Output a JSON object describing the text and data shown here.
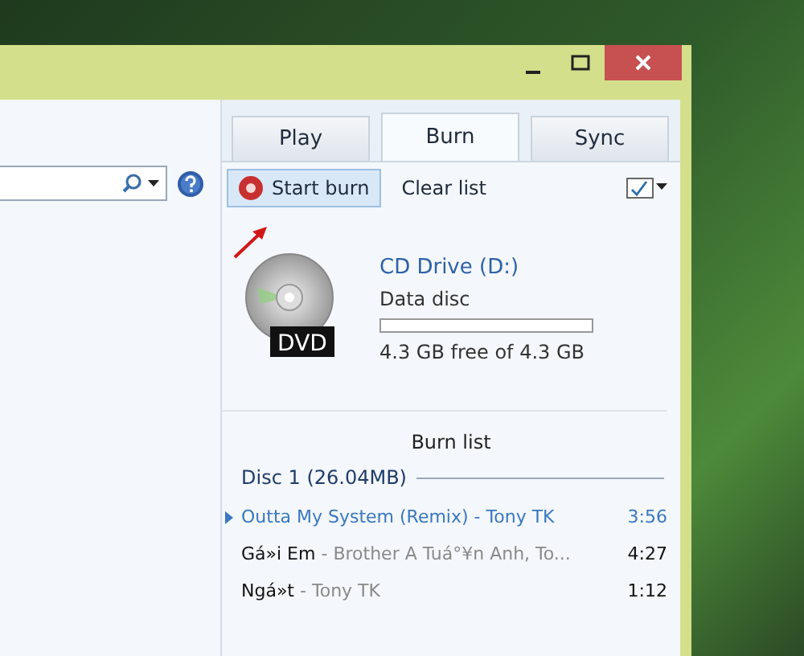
{
  "tabs": [
    {
      "label": "Play",
      "selected": false
    },
    {
      "label": "Burn",
      "selected": true
    },
    {
      "label": "Sync",
      "selected": false
    }
  ],
  "toolbar": {
    "buttons": [
      "Start burn",
      "Clear list"
    ]
  },
  "drive": {
    "name": "CD Drive (D:)",
    "disc_type": "Data disc",
    "level": 0,
    "free": "4.3 GB free of 4.3 GB",
    "disc_label": "DVD"
  },
  "burn_list": {
    "title": "Burn list",
    "disc": "Disc 1 (26.04MB)",
    "tracks": [
      {
        "title": "Outta My System (Remix)",
        "separator": "-",
        "artist": "Tony TK",
        "duration": "3:56",
        "playing": true
      },
      {
        "title": "Gá»i Em",
        "separator": "-",
        "artist": "Brother A Tuá°¥n Anh, To...",
        "duration": "4:27",
        "playing": false
      },
      {
        "title": "Ngá»t",
        "separator": "-",
        "artist": "Tony TK",
        "duration": "1:12",
        "playing": false
      }
    ]
  }
}
